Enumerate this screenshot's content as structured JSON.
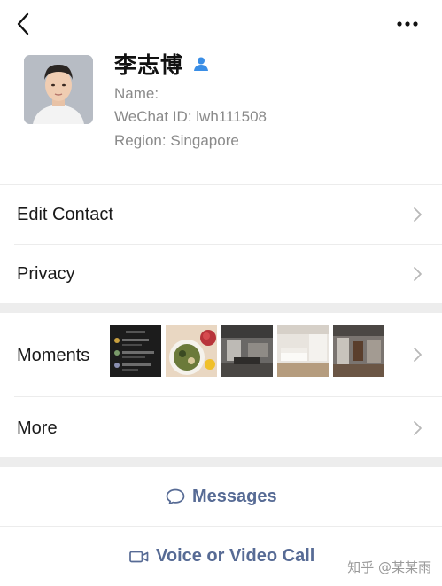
{
  "header": {
    "back_icon": "chevron-left-icon",
    "more_icon": "ellipsis-icon"
  },
  "profile": {
    "name": "李志博",
    "name_badge_icon": "contact-person-icon",
    "name_line": "Name:",
    "wechat_id_line": "WeChat ID: lwh111508",
    "region_line": "Region: Singapore"
  },
  "menu": {
    "edit_contact": "Edit Contact",
    "privacy": "Privacy",
    "moments": "Moments",
    "more": "More"
  },
  "actions": {
    "messages": "Messages",
    "call": "Voice or Video Call"
  },
  "watermark": "知乎 @某某雨",
  "colors": {
    "link_blue": "#576b95",
    "badge_blue": "#3a8ee6",
    "gap_gray": "#ededed"
  }
}
